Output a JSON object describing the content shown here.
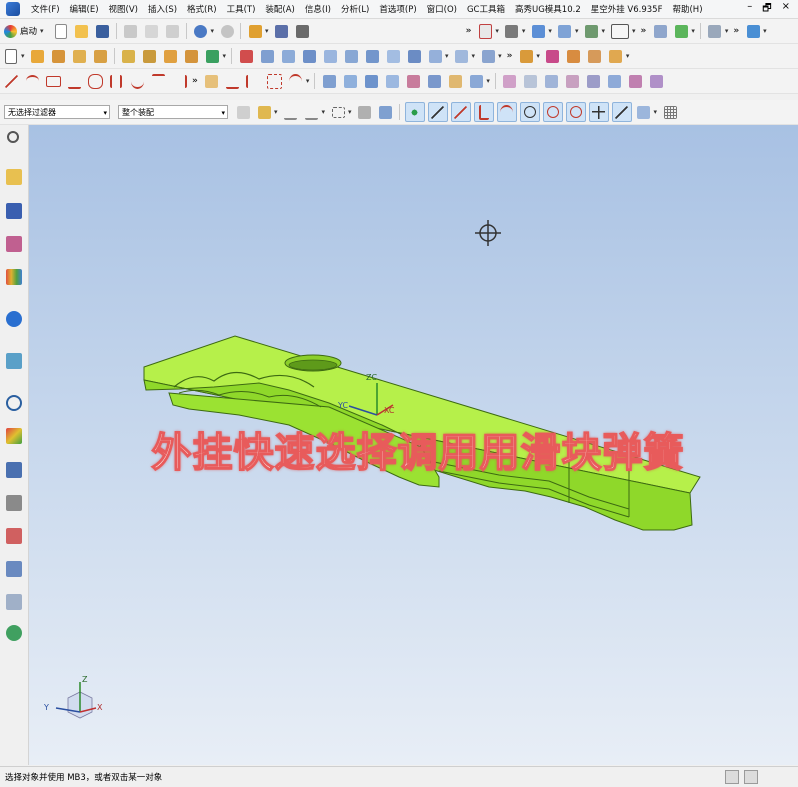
{
  "menubar": {
    "items": [
      "文件(F)",
      "编辑(E)",
      "视图(V)",
      "插入(S)",
      "格式(R)",
      "工具(T)",
      "装配(A)",
      "信息(I)",
      "分析(L)",
      "首选项(P)",
      "窗口(O)",
      "GC工具箱",
      "高秀UG模具10.2",
      "星空外挂 V6.935F",
      "帮助(H)"
    ],
    "win_min": "–",
    "win_restore": "🗗",
    "win_close": "×"
  },
  "toolbar": {
    "start_label": "启动",
    "overflow": "»"
  },
  "selection_bar": {
    "filter_value": "无选择过滤器",
    "scope_value": "整个装配"
  },
  "viewport": {
    "overlay_caption": "外挂快速选择调用用滑块弹簧",
    "csys_labels": {
      "zc": "ZC",
      "yc": "YC",
      "xc": "XC"
    },
    "triad_labels": {
      "z": "Z",
      "y": "Y",
      "x": "X"
    }
  },
  "status": {
    "message": "选择对象并使用 MB3，或者双击某一对象"
  },
  "colors": {
    "part_green": "#99e62d",
    "viewport_top": "#a8c1e3",
    "viewport_bottom": "#e8eef6"
  }
}
